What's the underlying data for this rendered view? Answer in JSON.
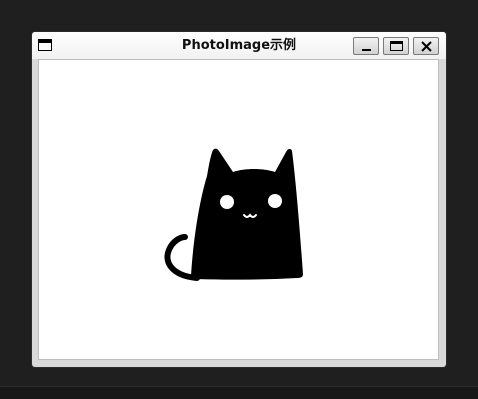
{
  "window": {
    "title": "PhotoImage示例",
    "controls": {
      "minimize": "minimize-icon",
      "maximize": "maximize-icon",
      "close": "close-icon"
    }
  },
  "content": {
    "image": "cat-image"
  },
  "colors": {
    "desktop": "#1f1f1f",
    "titlebar": "#ffffff",
    "canvas": "#ffffff",
    "cat": "#000000"
  }
}
